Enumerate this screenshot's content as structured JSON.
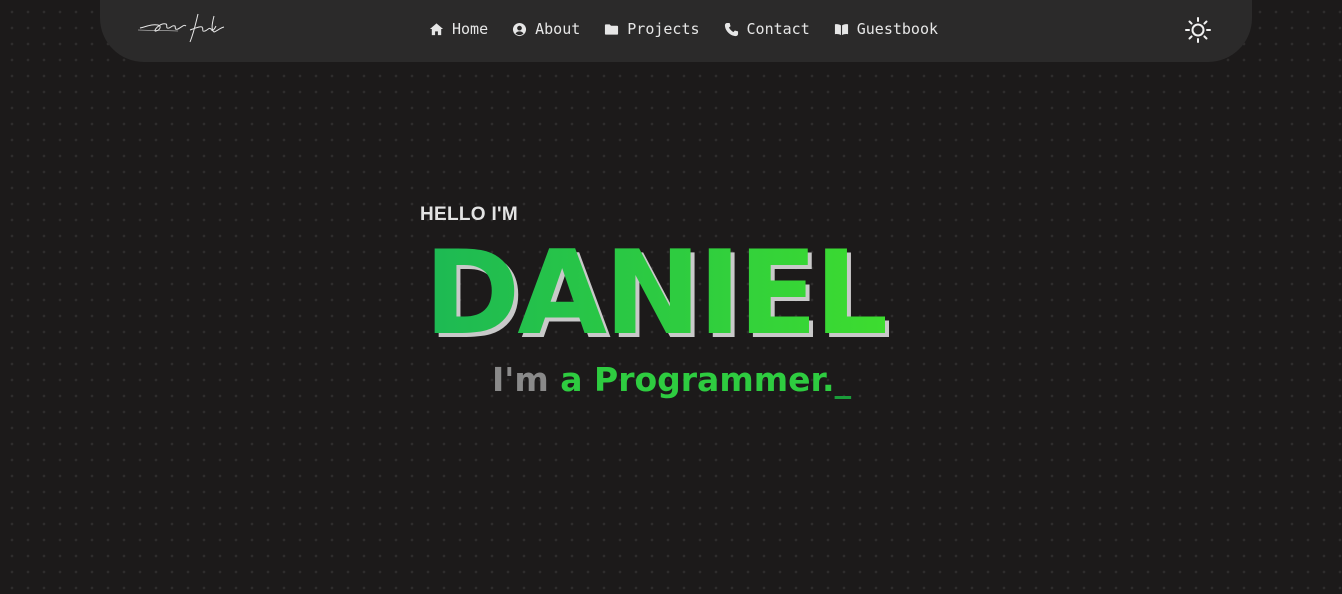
{
  "nav": {
    "items": [
      {
        "label": "Home",
        "icon": "home-icon"
      },
      {
        "label": "About",
        "icon": "user-circle-icon"
      },
      {
        "label": "Projects",
        "icon": "folder-icon"
      },
      {
        "label": "Contact",
        "icon": "phone-icon"
      },
      {
        "label": "Guestbook",
        "icon": "book-open-icon"
      }
    ],
    "theme_toggle_icon": "sun-icon",
    "logo": "signature-logo"
  },
  "hero": {
    "greeting": "HELLO I'M",
    "name": "DANIEL",
    "tagline_prefix": "I'm ",
    "tagline_role": "a Programmer.",
    "tagline_cursor": "_"
  },
  "colors": {
    "background": "#1c1a1a",
    "navbar": "#2b2a2a",
    "accent": "#2ecc40",
    "muted_text": "#8a8a8a",
    "name_shadow": "#c9c9c9"
  }
}
